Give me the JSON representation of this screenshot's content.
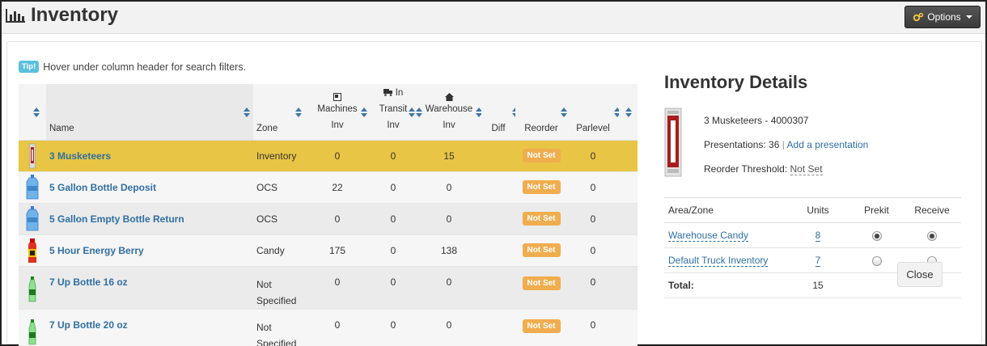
{
  "header": {
    "title": "Inventory",
    "options_label": "Options"
  },
  "tip": {
    "badge": "Tip!",
    "text": "Hover under column header for search filters."
  },
  "table": {
    "columns": {
      "name": "Name",
      "zone": "Zone",
      "machines": [
        "Machines",
        "Inv"
      ],
      "transit": [
        "In",
        "Transit",
        "Inv"
      ],
      "warehouse": [
        "Warehouse",
        "Inv"
      ],
      "diff": "Diff",
      "reorder": "Reorder",
      "parlevel": "Parlevel"
    },
    "rows": [
      {
        "name": "3 Musketeers",
        "zone": "Inventory",
        "zone2": "",
        "machines": "0",
        "transit": "0",
        "warehouse": "15",
        "diff": "",
        "reorder": "Not Set",
        "parlevel": "0",
        "icon": "candy-bar-icon"
      },
      {
        "name": "5 Gallon Bottle Deposit",
        "zone": "OCS",
        "zone2": "",
        "machines": "22",
        "transit": "0",
        "warehouse": "0",
        "diff": "",
        "reorder": "Not Set",
        "parlevel": "0",
        "icon": "water-jug-icon"
      },
      {
        "name": "5 Gallon Empty Bottle Return",
        "zone": "OCS",
        "zone2": "",
        "machines": "0",
        "transit": "0",
        "warehouse": "0",
        "diff": "",
        "reorder": "Not Set",
        "parlevel": "0",
        "icon": "water-jug-icon"
      },
      {
        "name": "5 Hour Energy Berry",
        "zone": "Candy",
        "zone2": "",
        "machines": "175",
        "transit": "0",
        "warehouse": "138",
        "diff": "",
        "reorder": "Not Set",
        "parlevel": "0",
        "icon": "energy-shot-icon"
      },
      {
        "name": "7 Up Bottle 16 oz",
        "zone": "Not",
        "zone2": "Specified",
        "machines": "0",
        "transit": "0",
        "warehouse": "0",
        "diff": "",
        "reorder": "Not Set",
        "parlevel": "0",
        "icon": "soda-bottle-icon"
      },
      {
        "name": "7 Up Bottle 20 oz",
        "zone": "Not",
        "zone2": "Specified",
        "machines": "0",
        "transit": "0",
        "warehouse": "0",
        "diff": "",
        "reorder": "Not Set",
        "parlevel": "0",
        "icon": "soda-bottle-icon"
      }
    ]
  },
  "details": {
    "title": "Inventory Details",
    "product": "3 Musketeers - 4000307",
    "presentations_label": "Presentations: 36",
    "separator": "|",
    "add_presentation": "Add a presentation",
    "reorder_label": "Reorder Threshold:",
    "reorder_value": "Not Set",
    "zone_table": {
      "headers": [
        "Area/Zone",
        "Units",
        "Prekit",
        "Receive"
      ],
      "rows": [
        {
          "zone": "Warehouse Candy",
          "units": "8",
          "prekit": true,
          "receive": true
        },
        {
          "zone": "Default Truck Inventory",
          "units": "7",
          "prekit": false,
          "receive": false
        }
      ],
      "total_label": "Total:",
      "total_value": "15"
    },
    "close_label": "Close"
  },
  "colors": {
    "selected_row": "#e8c544",
    "link": "#2f6fa3",
    "badge": "#f0ad4e",
    "tip": "#5bc0de"
  }
}
